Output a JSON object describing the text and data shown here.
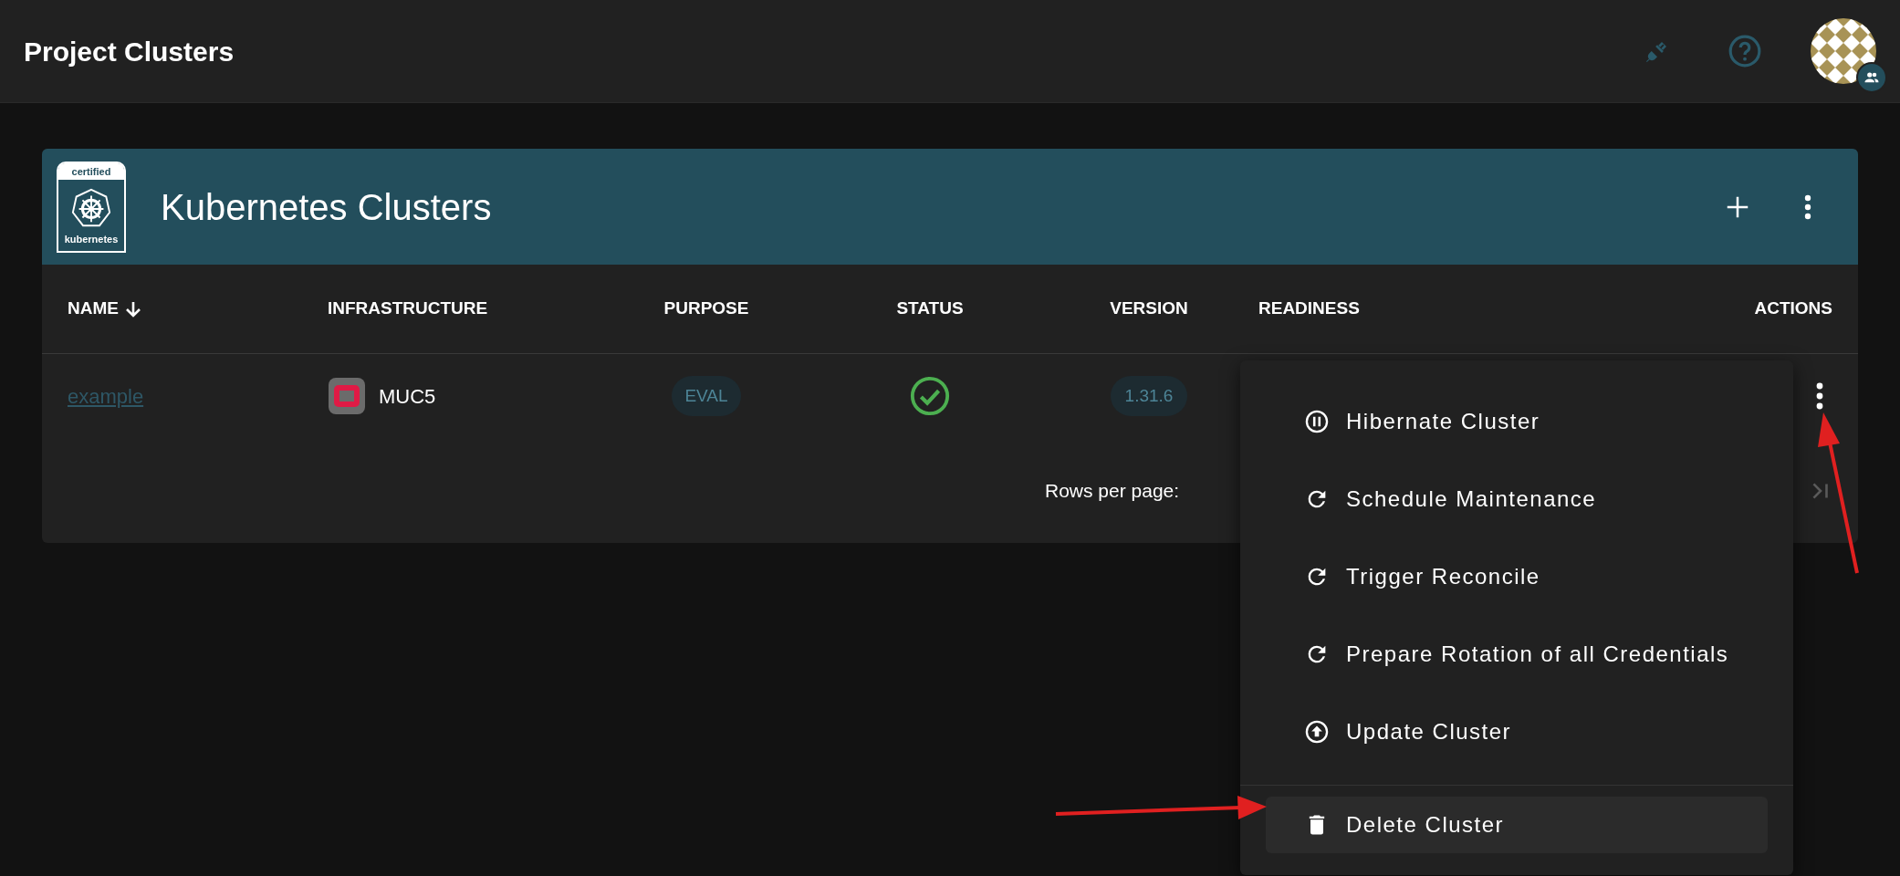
{
  "app_bar": {
    "title": "Project Clusters"
  },
  "card": {
    "title": "Kubernetes Clusters",
    "logo": {
      "top": "certified",
      "bottom": "kubernetes"
    }
  },
  "table": {
    "columns": [
      {
        "label": "NAME",
        "sorted": true
      },
      {
        "label": "INFRASTRUCTURE",
        "sorted": false
      },
      {
        "label": "PURPOSE",
        "sorted": false
      },
      {
        "label": "STATUS",
        "sorted": false
      },
      {
        "label": "VERSION",
        "sorted": false
      },
      {
        "label": "READINESS",
        "sorted": false
      },
      {
        "label": "ACTIONS",
        "sorted": false
      }
    ],
    "rows": [
      {
        "name": "example",
        "infrastructure": "MUC5",
        "purpose": "EVAL",
        "version": "1.31.6"
      }
    ]
  },
  "pagination": {
    "label": "Rows per page:"
  },
  "menu": {
    "groups": [
      [
        {
          "label": "Hibernate Cluster",
          "selected": false
        },
        {
          "label": "Schedule Maintenance",
          "selected": false
        },
        {
          "label": "Trigger Reconcile",
          "selected": false
        },
        {
          "label": "Prepare Rotation of all Credentials",
          "selected": false
        },
        {
          "label": "Update Cluster",
          "selected": false
        }
      ],
      [
        {
          "label": "Delete Cluster",
          "selected": true
        }
      ]
    ]
  }
}
